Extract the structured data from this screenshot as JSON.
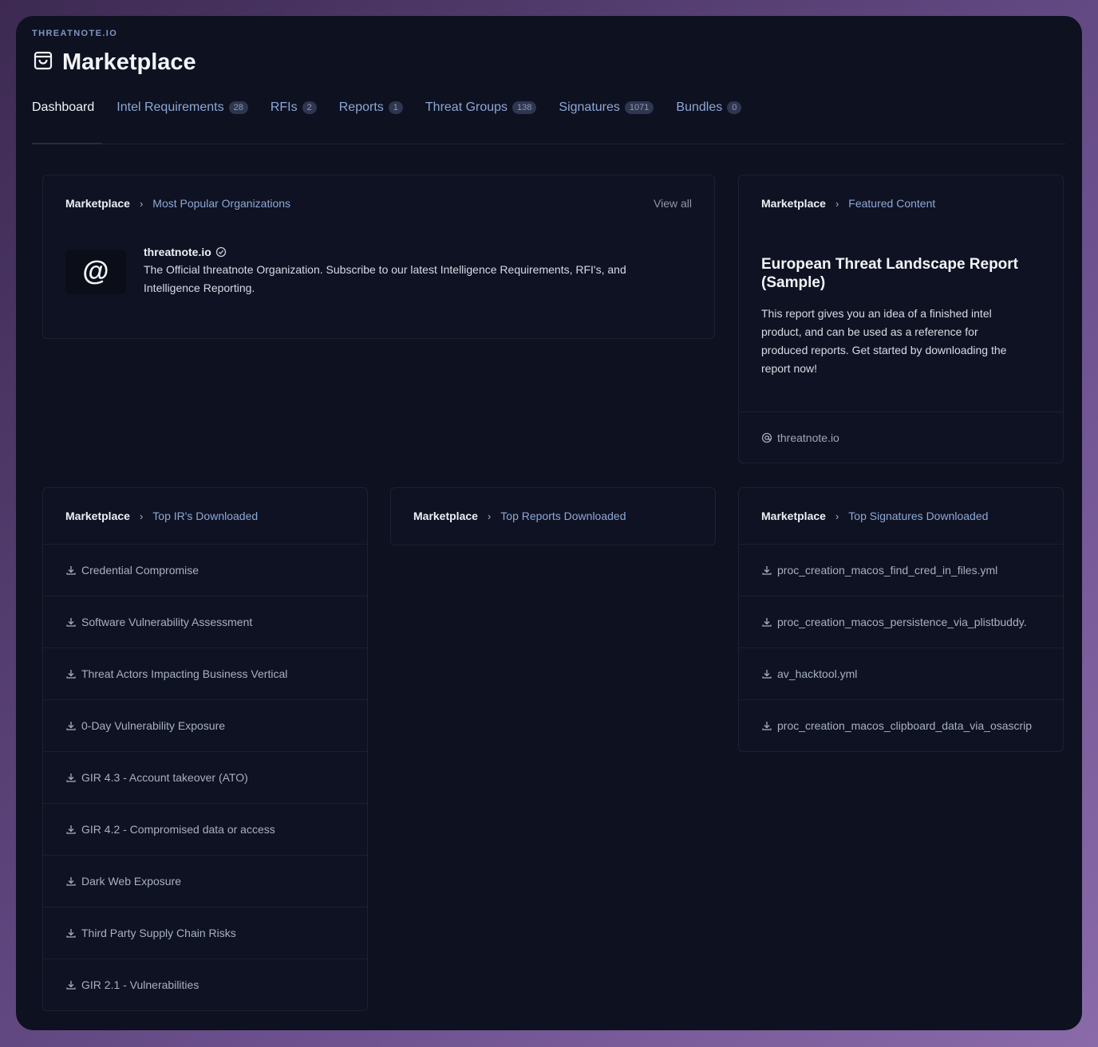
{
  "header": {
    "org_label": "THREATNOTE.IO",
    "title": "Marketplace",
    "icon": "shopping-bag-icon"
  },
  "tabs": [
    {
      "label": "Dashboard",
      "count": null,
      "active": true
    },
    {
      "label": "Intel Requirements",
      "count": "28"
    },
    {
      "label": "RFIs",
      "count": "2"
    },
    {
      "label": "Reports",
      "count": "1"
    },
    {
      "label": "Threat Groups",
      "count": "138"
    },
    {
      "label": "Signatures",
      "count": "1071"
    },
    {
      "label": "Bundles",
      "count": "0"
    }
  ],
  "popular_orgs": {
    "crumb_root": "Marketplace",
    "crumb_current": "Most Popular Organizations",
    "view_all": "View all",
    "avatar_glyph": "@",
    "org_name": "threatnote.io",
    "org_desc_line1": "The Official threatnote Organization. Subscribe to our latest Intelligence Requirements, RFI's, and",
    "org_desc_line2": "Intelligence Reporting."
  },
  "featured": {
    "crumb_root": "Marketplace",
    "crumb_current": "Featured Content",
    "title_line1": "European Threat Landscape Report",
    "title_line2": "(Sample)",
    "desc_lines": [
      "This report gives you an idea of a finished intel",
      "product, and can be used as a reference for",
      "produced reports. Get started by downloading the",
      "report now!"
    ],
    "footer": "threatnote.io"
  },
  "top_irs": {
    "crumb_root": "Marketplace",
    "crumb_current": "Top IR's Downloaded",
    "items": [
      "Credential Compromise",
      "Software Vulnerability Assessment",
      "Threat Actors Impacting Business Vertical",
      "0-Day Vulnerability Exposure",
      "GIR 4.3 - Account takeover (ATO)",
      "GIR 4.2 - Compromised data or access",
      "Dark Web Exposure",
      "Third Party Supply Chain Risks",
      "GIR 2.1 - Vulnerabilities"
    ]
  },
  "top_reports": {
    "crumb_root": "Marketplace",
    "crumb_current": "Top Reports Downloaded"
  },
  "top_signatures": {
    "crumb_root": "Marketplace",
    "crumb_current": "Top Signatures Downloaded",
    "items": [
      "proc_creation_macos_find_cred_in_files.yml",
      "proc_creation_macos_persistence_via_plistbuddy.",
      "av_hacktool.yml",
      "proc_creation_macos_clipboard_data_via_osascrip"
    ]
  },
  "colors": {
    "background": "#0e1120",
    "accent_link": "#8ea8d6",
    "border": "#1c2134"
  }
}
